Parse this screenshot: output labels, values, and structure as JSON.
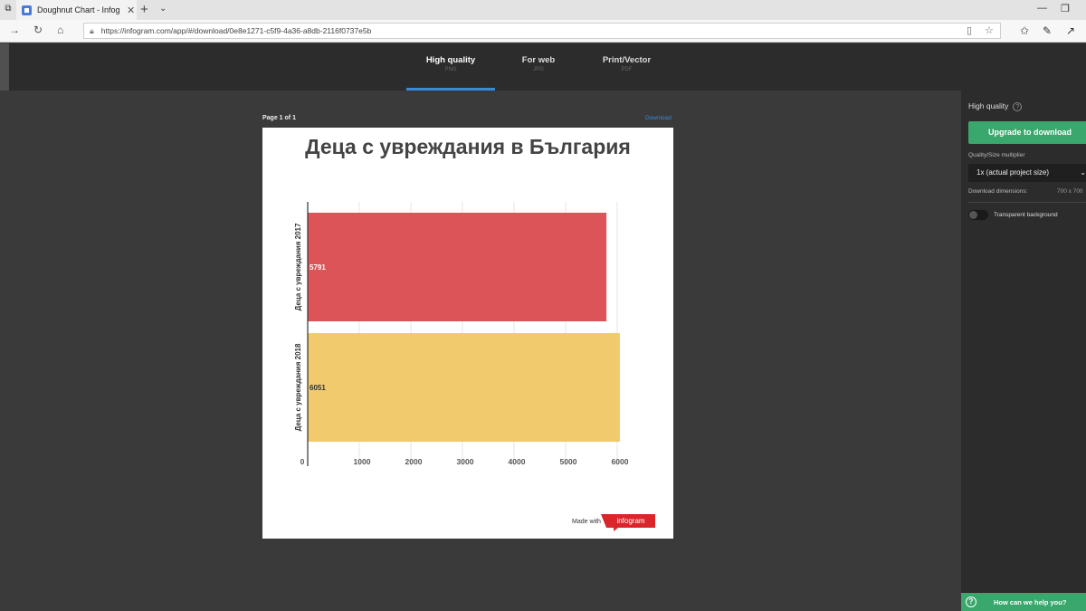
{
  "browser": {
    "tab_title": "Doughnut Chart - Infog",
    "url": "https://infogram.com/app/#/download/0e8e1271-c5f9-4a36-a8db-2116f0737e5b"
  },
  "formats": [
    {
      "label": "High quality",
      "sub": "PNG",
      "active": true
    },
    {
      "label": "For web",
      "sub": "JPG",
      "active": false
    },
    {
      "label": "Print/Vector",
      "sub": "PDF",
      "active": false
    }
  ],
  "page": {
    "info": "Page 1 of 1",
    "download_link": "Download",
    "made_with": "Made with",
    "logo_text": "infogram"
  },
  "panel": {
    "title": "High quality",
    "upgrade_button": "Upgrade to download",
    "quality_label": "Quality/Size multiplier",
    "quality_value": "1x (actual project size)",
    "dimensions_label": "Download dimensions:",
    "dimensions_value": "700 x 700",
    "transparent_label": "Transparent background",
    "help_bar": "How can we help you?"
  },
  "colors": {
    "accent_blue": "#3a8ad9",
    "green": "#3aa76d",
    "bar_2017": "#dc5457",
    "bar_2018": "#f0ca6d"
  },
  "chart_data": {
    "type": "bar",
    "orientation": "horizontal",
    "title": "Деца с увреждания в България",
    "categories": [
      "Деца с увреждания 2017",
      "Деца с увреждания 2018"
    ],
    "values": [
      5791,
      6051
    ],
    "data_labels": [
      "5791",
      "6051"
    ],
    "xlim": [
      0,
      6000
    ],
    "ticks": [
      "0",
      "1000",
      "2000",
      "3000",
      "4000",
      "5000",
      "6000"
    ],
    "grid": true
  }
}
